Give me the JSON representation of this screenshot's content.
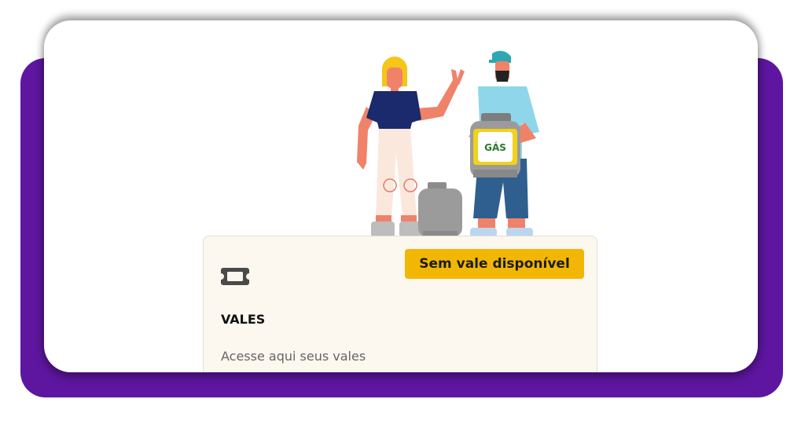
{
  "colors": {
    "page_background": "#ffffff",
    "frame_purple": "#5e16a0",
    "card_background": "#fcf7ef",
    "badge_yellow": "#f2b705"
  },
  "hero": {
    "illustration": "two-people-with-gas-cylinders-illustration",
    "cylinder_label": "GÁS"
  },
  "vales": {
    "icon": "ticket-icon",
    "status_badge": "Sem vale disponível",
    "title": "VALES",
    "description": "Acesse aqui seus vales"
  }
}
